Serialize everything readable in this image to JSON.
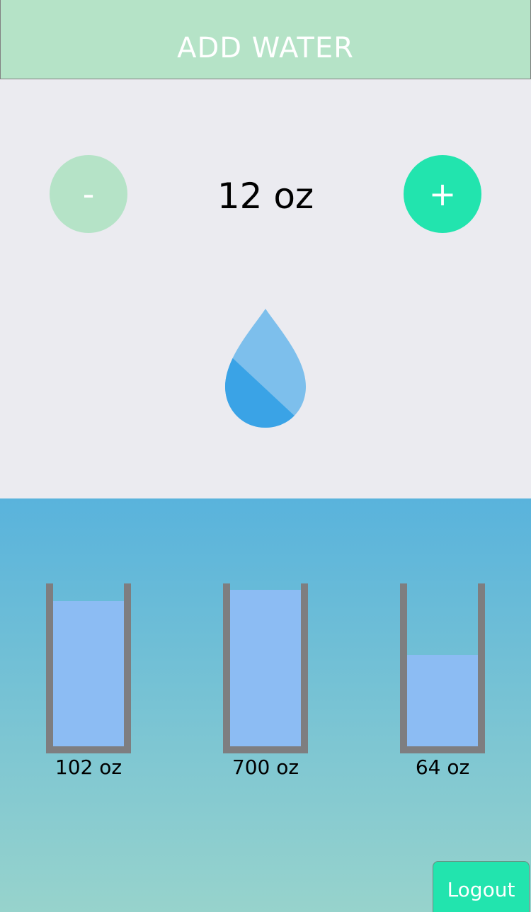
{
  "header": {
    "add_water_label": "ADD WATER"
  },
  "selector": {
    "minus_label": "-",
    "plus_label": "+",
    "amount": "12 oz",
    "drop_icon": "water-drop-icon"
  },
  "history": {
    "glasses": [
      {
        "label": "102 oz",
        "fill_fraction": 0.89
      },
      {
        "label": "700 oz",
        "fill_fraction": 0.96
      },
      {
        "label": "64 oz",
        "fill_fraction": 0.56
      }
    ]
  },
  "logout_label": "Logout",
  "colors": {
    "header_bg": "#b5e3c7",
    "minus_bg": "#b5e3c7",
    "plus_bg": "#22e4ae",
    "selector_bg": "#ebebf0",
    "gradient_top": "#59b3dc",
    "gradient_bottom": "#97d3cc",
    "glass_border": "#7e7e80",
    "glass_fill": "#8cbcf3",
    "logout_bg": "#22e4ae"
  }
}
